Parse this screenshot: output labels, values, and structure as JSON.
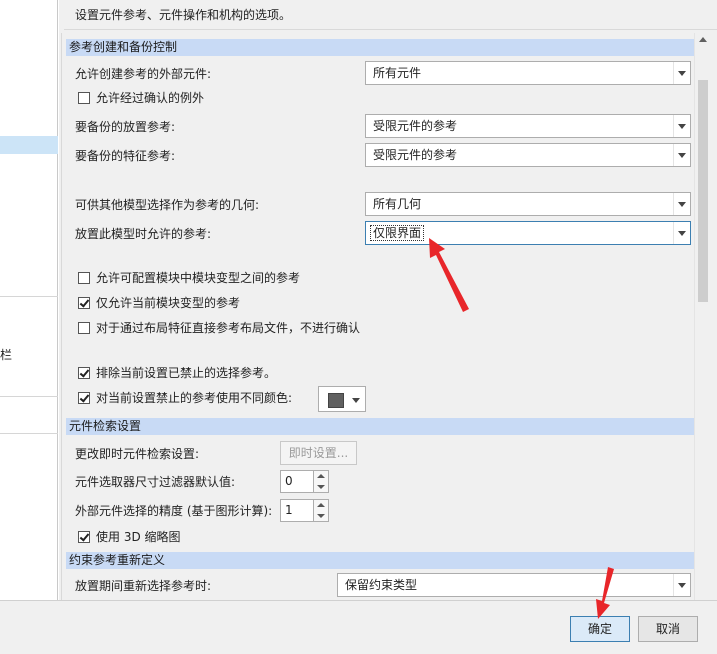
{
  "description": "设置元件参考、元件操作和机构的选项。",
  "left_panel": {
    "partial_text": "栏"
  },
  "sections": {
    "ref_creation": "参考创建和备份控制",
    "component_retrieval": "元件检索设置",
    "constraint_redefine": "约束参考重新定义"
  },
  "ref": {
    "allow_external_label": "允许创建参考的外部元件:",
    "allow_external_value": "所有元件",
    "allow_confirmed_exceptions": "允许经过确认的例外",
    "placement_backup_label": "要备份的放置参考:",
    "placement_backup_value": "受限元件的参考",
    "feature_backup_label": "要备份的特征参考:",
    "feature_backup_value": "受限元件的参考",
    "geom_available_label": "可供其他模型选择作为参考的几何:",
    "geom_available_value": "所有几何",
    "allowed_refs_label": "放置此模型时允许的参考:",
    "allowed_refs_value": "仅限界面",
    "allow_config_module_refs": "允许可配置模块中模块变型之间的参考",
    "only_current_variant_refs": "仅允许当前模块变型的参考",
    "layout_refs_no_confirm": "对于通过布局特征直接参考布局文件，不进行确认",
    "exclude_prohibited": "排除当前设置已禁止的选择参考。",
    "different_color": "对当前设置禁止的参考使用不同颜色:"
  },
  "retrieval": {
    "instant_label": "更改即时元件检索设置:",
    "instant_button": "即时设置...",
    "size_filter_label": "元件选取器尺寸过滤器默认值:",
    "size_filter_value": "0",
    "precision_label": "外部元件选择的精度 (基于图形计算):",
    "precision_value": "1",
    "use_3d_thumbnail": "使用 3D 缩略图"
  },
  "constraint": {
    "reselect_label": "放置期间重新选择参考时:",
    "reselect_value": "保留约束类型"
  },
  "footer": {
    "ok": "确定",
    "cancel": "取消"
  },
  "checkbox_states": {
    "allow_confirmed_exceptions": false,
    "allow_config_module_refs": false,
    "only_current_variant_refs": true,
    "layout_refs_no_confirm": false,
    "exclude_prohibited": true,
    "different_color": true,
    "use_3d_thumbnail": true
  },
  "colors": {
    "section_header": "#c8daf5",
    "color_swatch": "#606060",
    "accent": "#3c7fb1"
  }
}
